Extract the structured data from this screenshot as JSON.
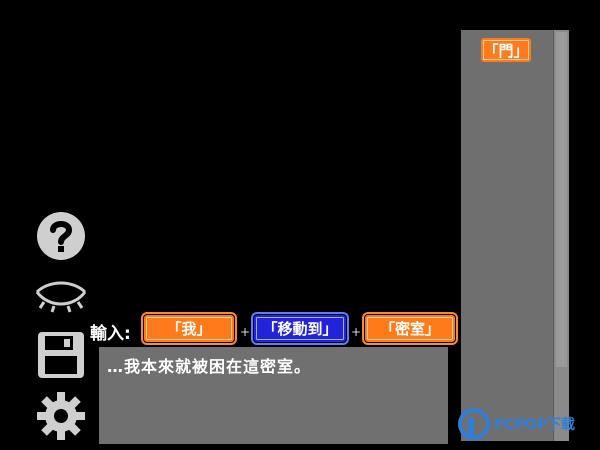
{
  "inventory": {
    "items": [
      {
        "label": "「門」",
        "color": "orange"
      }
    ]
  },
  "sentence_builder": {
    "label": "輸入:",
    "plus": "+",
    "parts": [
      {
        "label": "「我」",
        "color": "orange"
      },
      {
        "label": "「移動到」",
        "color": "blue"
      },
      {
        "label": "「密室」",
        "color": "orange"
      }
    ]
  },
  "dialogue": {
    "text": "…我本來就被困在這密室。"
  },
  "side_icons": [
    "help-icon",
    "eye-icon",
    "save-icon",
    "gear-icon"
  ],
  "watermark": {
    "text": "PCPOP下载"
  },
  "colors": {
    "orange": "#ff7a1a",
    "blue": "#2323d9",
    "panel_gray": "#6f6f6f",
    "textbox_gray": "#707070"
  }
}
